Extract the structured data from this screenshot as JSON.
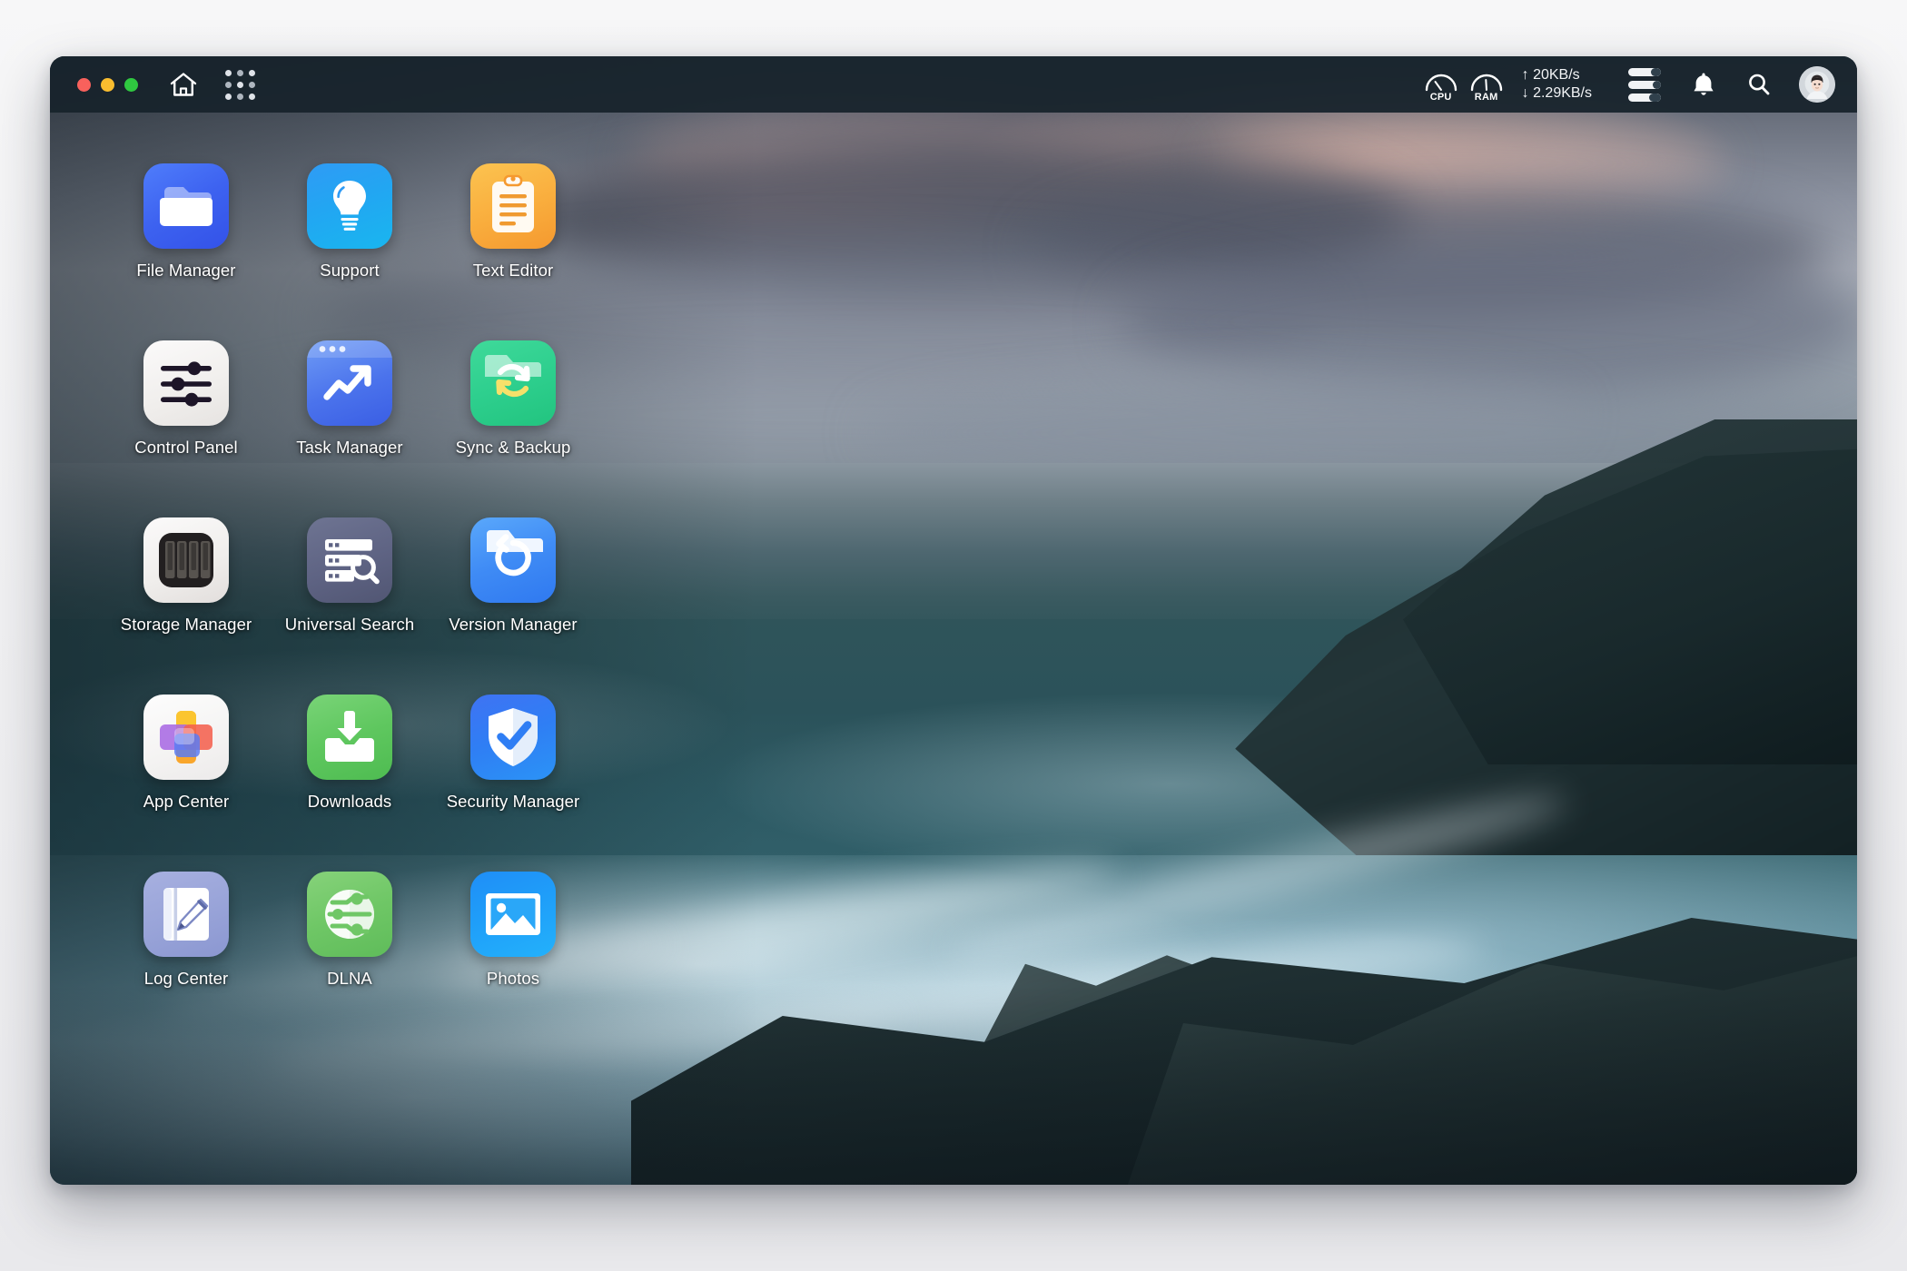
{
  "window": {
    "titlebar": {
      "traffic_lights": [
        {
          "name": "close",
          "color": "#f8615c"
        },
        {
          "name": "minimize",
          "color": "#f9bd2f"
        },
        {
          "name": "maximize",
          "color": "#2fc840"
        }
      ],
      "home_label": "Home",
      "apps_label": "All Applications"
    },
    "status": {
      "cpu_label": "CPU",
      "ram_label": "RAM",
      "upload_speed": "↑ 20KB/s",
      "download_speed": "↓ 2.29KB/s",
      "resource_monitor_label": "Resource Monitor",
      "notifications_label": "Notifications",
      "search_label": "Search",
      "account_label": "Account"
    }
  },
  "desktop": {
    "icons": [
      {
        "id": "file-manager",
        "label": "File Manager",
        "icon": "folder-icon",
        "tile_class": "bg-filemanager"
      },
      {
        "id": "support",
        "label": "Support",
        "icon": "lightbulb-icon",
        "tile_class": "bg-support"
      },
      {
        "id": "text-editor",
        "label": "Text Editor",
        "icon": "clipboard-icon",
        "tile_class": "bg-texteditor"
      },
      {
        "id": "control-panel",
        "label": "Control Panel",
        "icon": "sliders-icon",
        "tile_class": "bg-controlpanel"
      },
      {
        "id": "task-manager",
        "label": "Task Manager",
        "icon": "trending-up-icon",
        "tile_class": "bg-taskmanager"
      },
      {
        "id": "sync-backup",
        "label": "Sync & Backup",
        "icon": "sync-folder-icon",
        "tile_class": "bg-syncbackup"
      },
      {
        "id": "storage-manager",
        "label": "Storage Manager",
        "icon": "drive-bay-icon",
        "tile_class": "bg-storage"
      },
      {
        "id": "universal-search",
        "label": "Universal Search",
        "icon": "server-search-icon",
        "tile_class": "bg-unisearch"
      },
      {
        "id": "version-manager",
        "label": "Version Manager",
        "icon": "undo-folder-icon",
        "tile_class": "bg-version"
      },
      {
        "id": "app-center",
        "label": "App Center",
        "icon": "app-blocks-icon",
        "tile_class": "bg-appcenter"
      },
      {
        "id": "downloads",
        "label": "Downloads",
        "icon": "download-tray-icon",
        "tile_class": "bg-downloads"
      },
      {
        "id": "security-manager",
        "label": "Security Manager",
        "icon": "shield-check-icon",
        "tile_class": "bg-security"
      },
      {
        "id": "log-center",
        "label": "Log Center",
        "icon": "notebook-pen-icon",
        "tile_class": "bg-logcenter"
      },
      {
        "id": "dlna",
        "label": "DLNA",
        "icon": "network-share-icon",
        "tile_class": "bg-dlna"
      },
      {
        "id": "photos",
        "label": "Photos",
        "icon": "photo-icon",
        "tile_class": "bg-photos"
      }
    ],
    "wallpaper_description": "Long-exposure seascape at dusk with waves washing over dark rocks"
  }
}
